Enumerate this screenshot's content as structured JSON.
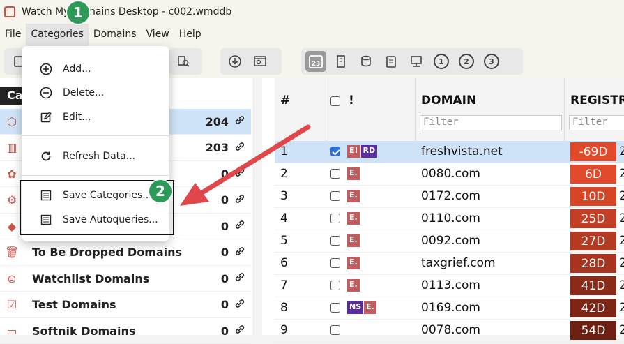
{
  "window": {
    "title": "Watch My Domains Desktop - c002.wmddb"
  },
  "menubar": {
    "items": [
      "File",
      "Categories",
      "Domains",
      "View",
      "Help"
    ]
  },
  "toolbar": {
    "circles": [
      "1",
      "2",
      "3"
    ],
    "calendar_label": "23"
  },
  "left_pane": {
    "header": "Ca",
    "rows": [
      {
        "name": "",
        "count": "204",
        "icon": "cube-icon",
        "selected": true,
        "link": "↔"
      },
      {
        "name": "",
        "count": "203",
        "icon": "building-icon",
        "link": "🔗"
      },
      {
        "name": "",
        "count": "0",
        "icon": "award-icon",
        "link": "🔗"
      },
      {
        "name": "",
        "count": "0",
        "icon": "gear-icon",
        "link": "🔗"
      },
      {
        "name": "",
        "count": "0",
        "icon": "gem-icon",
        "link": "🔗"
      },
      {
        "name": "To Be Dropped Domains",
        "count": "0",
        "icon": "trash-icon",
        "link": "🔗"
      },
      {
        "name": "Watchlist Domains",
        "count": "0",
        "icon": "disk-icon",
        "link": "🔗"
      },
      {
        "name": "Test Domains",
        "count": "0",
        "icon": "clipboard-icon",
        "link": "🔗"
      },
      {
        "name": "Softnik Domains",
        "count": "0",
        "icon": "folder-icon",
        "link": "🔗"
      }
    ]
  },
  "table": {
    "headers": {
      "num": "#",
      "bang": "!",
      "domain": "DOMAIN",
      "registrar": "REGISTR"
    },
    "filter_placeholder": "Filter",
    "rows": [
      {
        "num": "1",
        "checked": true,
        "badges": [
          "E!",
          "RD"
        ],
        "domain": "freshvista.net",
        "reg": "-69D",
        "color": "#e04a2a",
        "trail": "2"
      },
      {
        "num": "2",
        "checked": false,
        "badges": [
          "E."
        ],
        "domain": "0080.com",
        "reg": "6D",
        "color": "#e04a2a",
        "trail": "2"
      },
      {
        "num": "3",
        "checked": false,
        "badges": [
          "E."
        ],
        "domain": "0172.com",
        "reg": "10D",
        "color": "#d64526",
        "trail": "2"
      },
      {
        "num": "4",
        "checked": false,
        "badges": [
          "E."
        ],
        "domain": "0110.com",
        "reg": "25D",
        "color": "#c23e24",
        "trail": "2"
      },
      {
        "num": "5",
        "checked": false,
        "badges": [
          "E."
        ],
        "domain": "0092.com",
        "reg": "27D",
        "color": "#b53a22",
        "trail": "2"
      },
      {
        "num": "6",
        "checked": false,
        "badges": [
          "E."
        ],
        "domain": "taxgrief.com",
        "reg": "28D",
        "color": "#a83420",
        "trail": "2"
      },
      {
        "num": "7",
        "checked": false,
        "badges": [
          "E."
        ],
        "domain": "0113.com",
        "reg": "41D",
        "color": "#8a2a18",
        "trail": "2"
      },
      {
        "num": "8",
        "checked": false,
        "badges": [
          "NS",
          "E."
        ],
        "domain": "0169.com",
        "reg": "42D",
        "color": "#7e2616",
        "trail": "2"
      },
      {
        "num": "9",
        "checked": false,
        "badges": [],
        "domain": "0078.com",
        "reg": "54D",
        "color": "#6e2012",
        "trail": "2"
      }
    ]
  },
  "dropdown": {
    "items": [
      {
        "label": "Add...",
        "icon": "plus-circle-icon",
        "glyph": "⊕"
      },
      {
        "label": "Delete...",
        "icon": "minus-circle-icon",
        "glyph": "⊖"
      },
      {
        "label": "Edit...",
        "icon": "edit-icon",
        "glyph": "✎"
      },
      {
        "label": "Refresh Data...",
        "icon": "refresh-icon",
        "glyph": "↻"
      },
      {
        "label": "Save Categories...",
        "icon": "list-icon",
        "glyph": "☰"
      },
      {
        "label": "Save Autoqueries...",
        "icon": "list-icon",
        "glyph": "☰"
      }
    ]
  },
  "callouts": [
    "1",
    "2"
  ],
  "colors": {
    "accent": "#2e9a5a",
    "arrow": "#e0474a",
    "selection": "#cfe3f8"
  }
}
